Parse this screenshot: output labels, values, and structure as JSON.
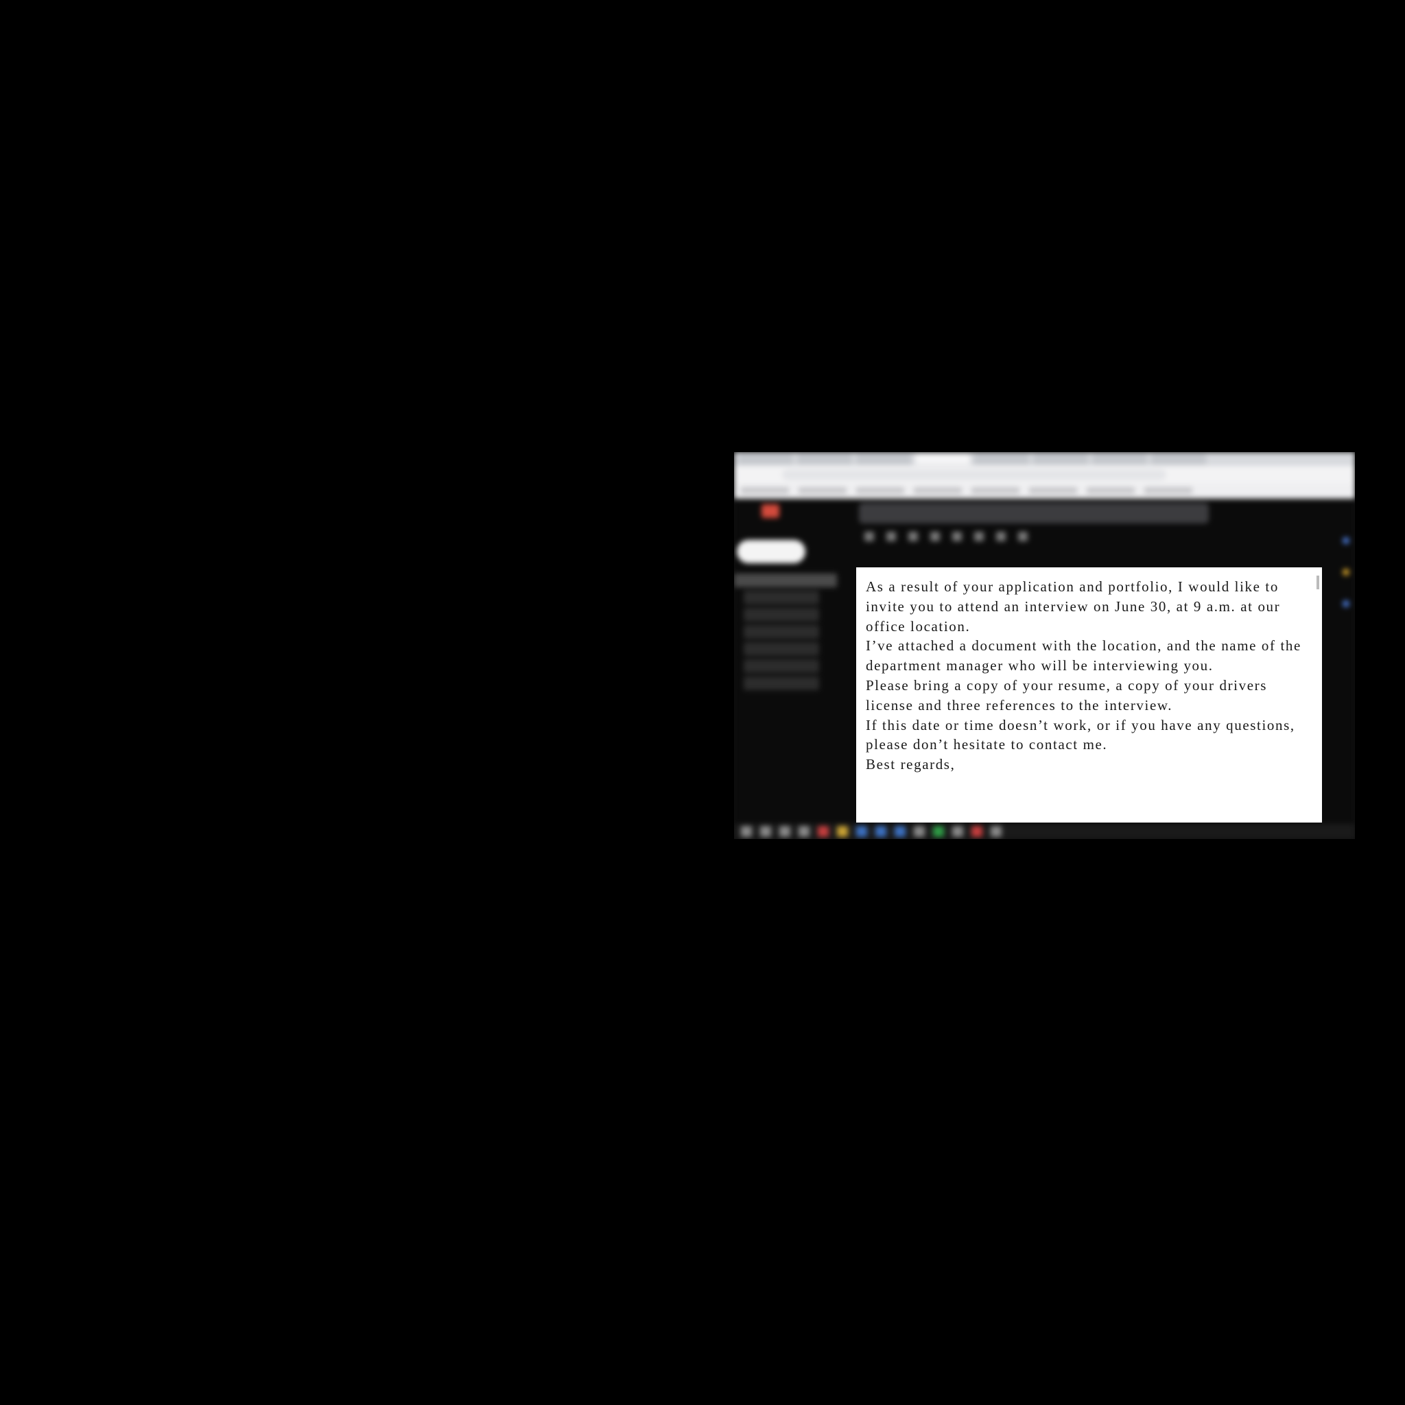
{
  "email": {
    "lines": [
      "As a result of your application and portfolio, I would like to invite you to attend an interview on June 30, at 9 a.m. at our office location.",
      "I’ve attached a document with the location, and the name of the department manager who will be interviewing you.",
      "Please bring a copy of your resume, a copy of your drivers license and three references to the interview.",
      "If this date or time doesn’t work, or if you have any questions, please don’t hesitate to contact  me.",
      "Best regards,"
    ]
  }
}
